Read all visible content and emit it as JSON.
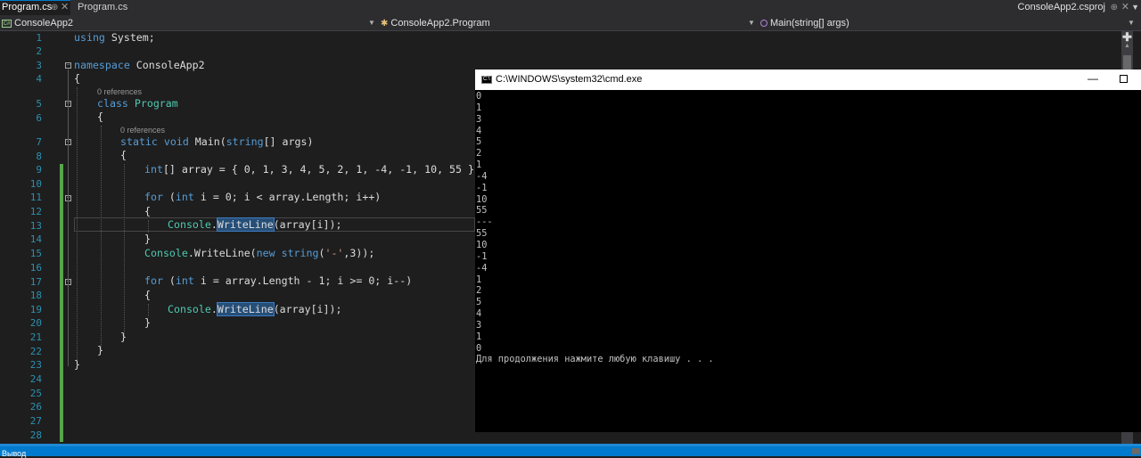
{
  "tabs": {
    "active": {
      "label": "Program.cs",
      "pin": "⊕",
      "close": "✕"
    },
    "second": {
      "label": "Program.cs"
    },
    "project": {
      "label": "ConsoleApp2.csproj",
      "pin": "⊕",
      "close": "✕"
    },
    "menu_icon": "chevron-down-icon"
  },
  "navbar": {
    "project": "ConsoleApp2",
    "type": "ConsoleApp2.Program",
    "member": "Main(string[] args)"
  },
  "editor": {
    "line_numbers": [
      "1",
      "2",
      "3",
      "4",
      "5",
      "6",
      "7",
      "8",
      "9",
      "10",
      "11",
      "12",
      "13",
      "14",
      "15",
      "16",
      "17",
      "18",
      "19",
      "20",
      "21",
      "22",
      "23",
      "24",
      "25",
      "26",
      "27",
      "28"
    ],
    "codelens": {
      "class_refs": "0 references",
      "method_refs": "0 references"
    },
    "code": {
      "l1_kw": "using",
      "l1_rest": " System;",
      "l3_kw": "namespace",
      "l3_rest": " ConsoleApp2",
      "l4": "{",
      "l5_kw": "class",
      "l5_type": "Program",
      "l6": "{",
      "l7_kw1": "static",
      "l7_kw2": "void",
      "l7_name": "Main(",
      "l7_kw3": "string",
      "l7_rest": "[] args)",
      "l8": "{",
      "l9_kw": "int",
      "l9_rest1": "[] array = { ",
      "l9_values": "0, 1, 3, 4, 5, 2, 1, -4, -1, 10, 55",
      "l9_rest2": " };",
      "l11_kw1": "for",
      "l11_p1": " (",
      "l11_kw2": "int",
      "l11_rest": " i = 0; i < array.Length; i++)",
      "l12": "{",
      "l13_type": "Console",
      "l13_dot": ".",
      "l13_sel": "WriteLine",
      "l13_sel2": "(array[i]);",
      "l14": "}",
      "l15_type": "Console",
      "l15_mid": ".WriteLine(",
      "l15_kw": "new",
      "l15_sp": " ",
      "l15_kw2": "string",
      "l15_p": "(",
      "l15_str": "'-'",
      "l15_rest": ",3));",
      "l17_kw1": "for",
      "l17_p1": " (",
      "l17_kw2": "int",
      "l17_rest": " i = array.Length - 1; i >= 0; i--)",
      "l18": "{",
      "l19_type": "Console",
      "l19_dot": ".",
      "l19_sel": "WriteLine",
      "l19_rest": "(array[i]);",
      "l20": "}",
      "l21": "}",
      "l22": "}",
      "l23": "}"
    }
  },
  "console": {
    "title": "C:\\WINDOWS\\system32\\cmd.exe",
    "minimize": "—",
    "output": "0\n1\n3\n4\n5\n2\n1\n-4\n-1\n10\n55\n---\n55\n10\n-1\n-4\n1\n2\n5\n4\n3\n1\n0\nДля продолжения нажмите любую клавишу . . ."
  },
  "statusbar": {
    "label": "Вывод"
  },
  "colors": {
    "accent": "#007acc",
    "keyword": "#569cd6",
    "type": "#4ec9b0",
    "string": "#d69d85",
    "line_number": "#2b91af"
  }
}
